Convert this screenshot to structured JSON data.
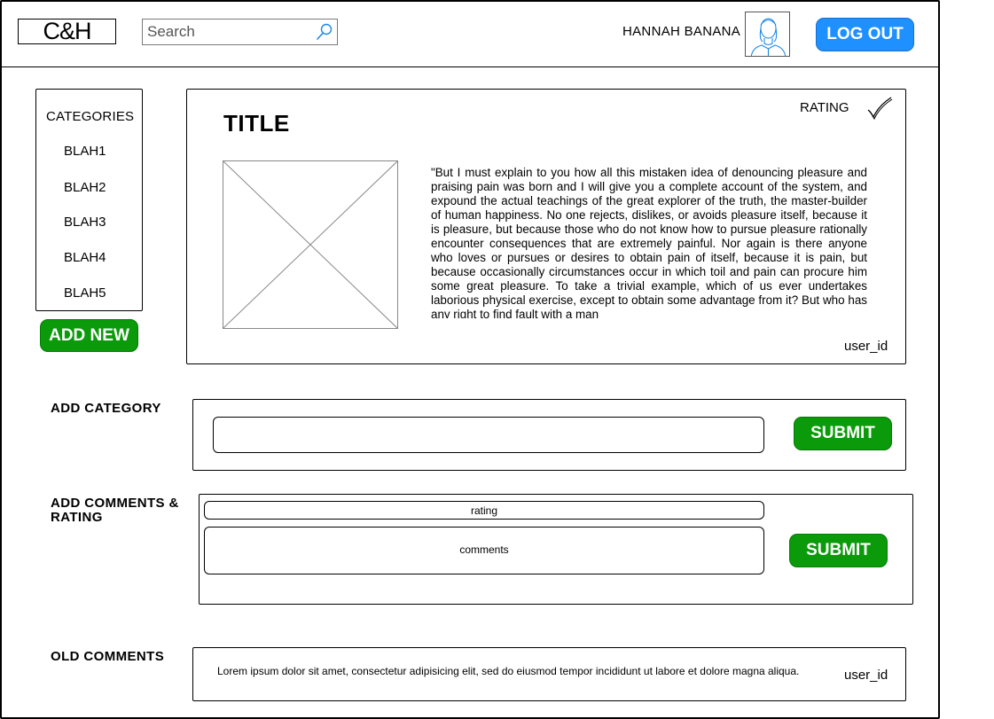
{
  "header": {
    "logo": "C&H",
    "search_placeholder": "Search",
    "username": "HANNAH BANANA",
    "logout_label": "LOG OUT"
  },
  "sidebar": {
    "title": "CATEGORIES",
    "items": [
      {
        "label": "BLAH1"
      },
      {
        "label": "BLAH2"
      },
      {
        "label": "BLAH3"
      },
      {
        "label": "BLAH4"
      },
      {
        "label": "BLAH5"
      }
    ],
    "add_new_label": "ADD NEW"
  },
  "post": {
    "title": "TITLE",
    "rating_label": "RATING",
    "body": "\"But I must explain to you how all this mistaken idea of denouncing pleasure and praising pain was born and I will give you a complete account of the system, and expound the actual teachings of the great explorer of the truth, the master-builder of human happiness. No one rejects, dislikes, or avoids pleasure itself, because it is pleasure, but because those who do not know how to pursue pleasure rationally encounter consequences that are extremely painful. Nor again is there anyone who loves or pursues or desires to obtain pain of itself, because it is pain, but because occasionally circumstances occur in which toil and pain can procure him some great pleasure. To take a trivial example, which of us ever undertakes laborious physical exercise, except to obtain some advantage from it? But who has any right to find fault with a man",
    "user_id": "user_id"
  },
  "add_category": {
    "label": "ADD CATEGORY",
    "input_value": "",
    "submit_label": "SUBMIT"
  },
  "add_comments": {
    "label": "ADD COMMENTS & RATING",
    "rating_placeholder": "rating",
    "comments_placeholder": "comments",
    "submit_label": "SUBMIT"
  },
  "old_comments": {
    "label": "OLD COMMENTS",
    "items": [
      {
        "text": "Lorem ipsum dolor sit amet, consectetur adipisicing elit, sed do eiusmod tempor incididunt ut labore et dolore magna aliqua.",
        "user_id": "user_id"
      }
    ]
  },
  "colors": {
    "logout_blue": "#1e90ff",
    "submit_green": "#0a9a0a"
  }
}
